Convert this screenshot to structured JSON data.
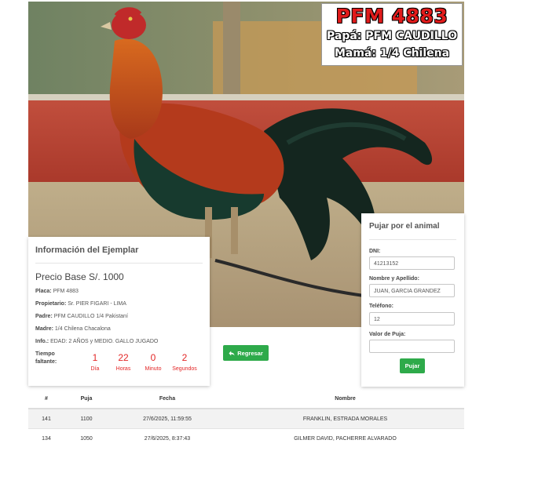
{
  "photo": {
    "code": "PFM 4883",
    "father_line": "Papá: PFM CAUDILLO",
    "mother_line": "Mamá:  1/4 Chilena"
  },
  "info": {
    "title": "Información del Ejemplar",
    "price": "Precio Base S/. 1000",
    "rows": [
      {
        "label": "Placa:",
        "value": "PFM 4883"
      },
      {
        "label": "Propietario:",
        "value": "Sr. PIER FIGARI - LIMA"
      },
      {
        "label": "Padre:",
        "value": "PFM CAUDILLO 1/4 Pakistaní"
      },
      {
        "label": "Madre:",
        "value": "1/4 Chilena Chacalona"
      },
      {
        "label": "Info.:",
        "value": "EDAD: 2 AÑOS y MEDIO. GALLO JUGADO"
      }
    ],
    "time_label": "Tiempo faltante:",
    "timer": [
      {
        "value": "1",
        "unit": "Día"
      },
      {
        "value": "22",
        "unit": "Horas"
      },
      {
        "value": "0",
        "unit": "Minuto"
      },
      {
        "value": "2",
        "unit": "Segundos"
      }
    ]
  },
  "back_button": "Regresar",
  "bid": {
    "title": "Pujar por el animal",
    "fields": [
      {
        "label": "DNI:",
        "value": "41213152"
      },
      {
        "label": "Nombre y Apellido:",
        "value": "JUAN, GARCIA GRANDEZ"
      },
      {
        "label": "Teléfono:",
        "value": "12"
      },
      {
        "label": "Valor de Puja:",
        "value": ""
      }
    ],
    "submit": "Pujar"
  },
  "table": {
    "headers": [
      "#",
      "Puja",
      "Fecha",
      "Nombre"
    ],
    "rows": [
      [
        "141",
        "1100",
        "27/6/2025, 11:59:55",
        "FRANKLIN, ESTRADA MORALES"
      ],
      [
        "134",
        "1050",
        "27/6/2025, 8:37:43",
        "GILMER DAVID, PACHERRE ALVARADO"
      ]
    ]
  },
  "colors": {
    "accent_green": "#2eaa4a",
    "timer_red": "#e32626",
    "code_red": "#e11b1b"
  },
  "icons": [
    "arrow-left-icon"
  ]
}
